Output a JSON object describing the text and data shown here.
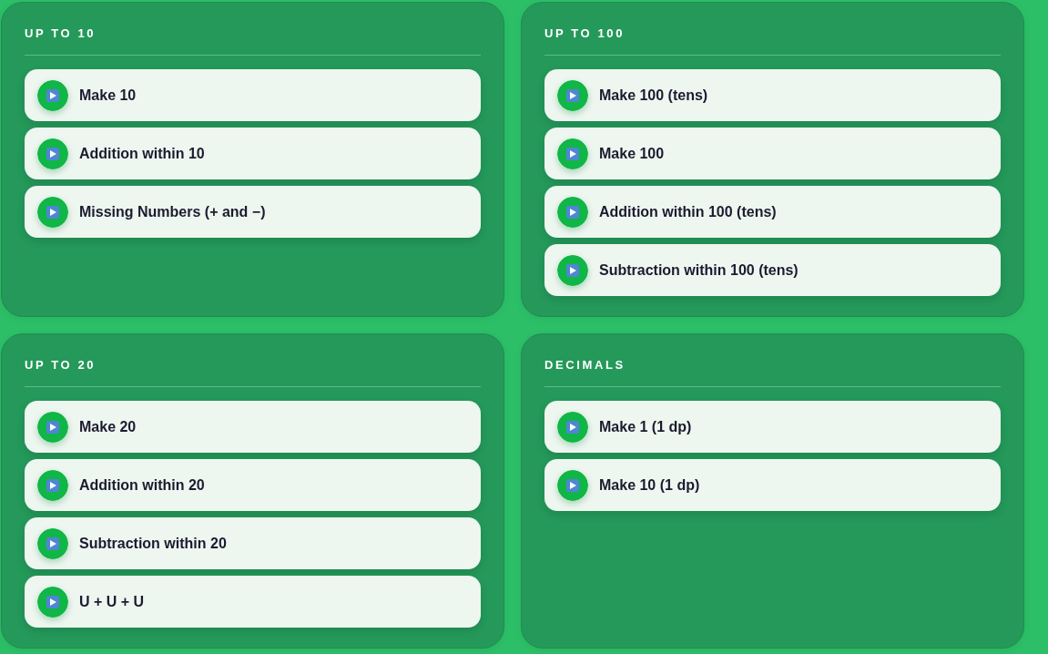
{
  "sections": [
    {
      "title": "UP TO 10",
      "items": [
        {
          "label": "Make 10"
        },
        {
          "label": "Addition within 10"
        },
        {
          "label": "Missing Numbers (+ and −)"
        }
      ]
    },
    {
      "title": "UP TO 100",
      "items": [
        {
          "label": "Make 100 (tens)"
        },
        {
          "label": "Make 100"
        },
        {
          "label": "Addition within 100 (tens)"
        },
        {
          "label": "Subtraction within 100 (tens)"
        }
      ]
    },
    {
      "title": "UP TO 20",
      "items": [
        {
          "label": "Make 20"
        },
        {
          "label": "Addition within 20"
        },
        {
          "label": "Subtraction within 20"
        },
        {
          "label": "U + U + U"
        }
      ]
    },
    {
      "title": "DECIMALS",
      "items": [
        {
          "label": "Make 1 (1 dp)"
        },
        {
          "label": "Make 10 (1 dp)"
        }
      ]
    }
  ]
}
